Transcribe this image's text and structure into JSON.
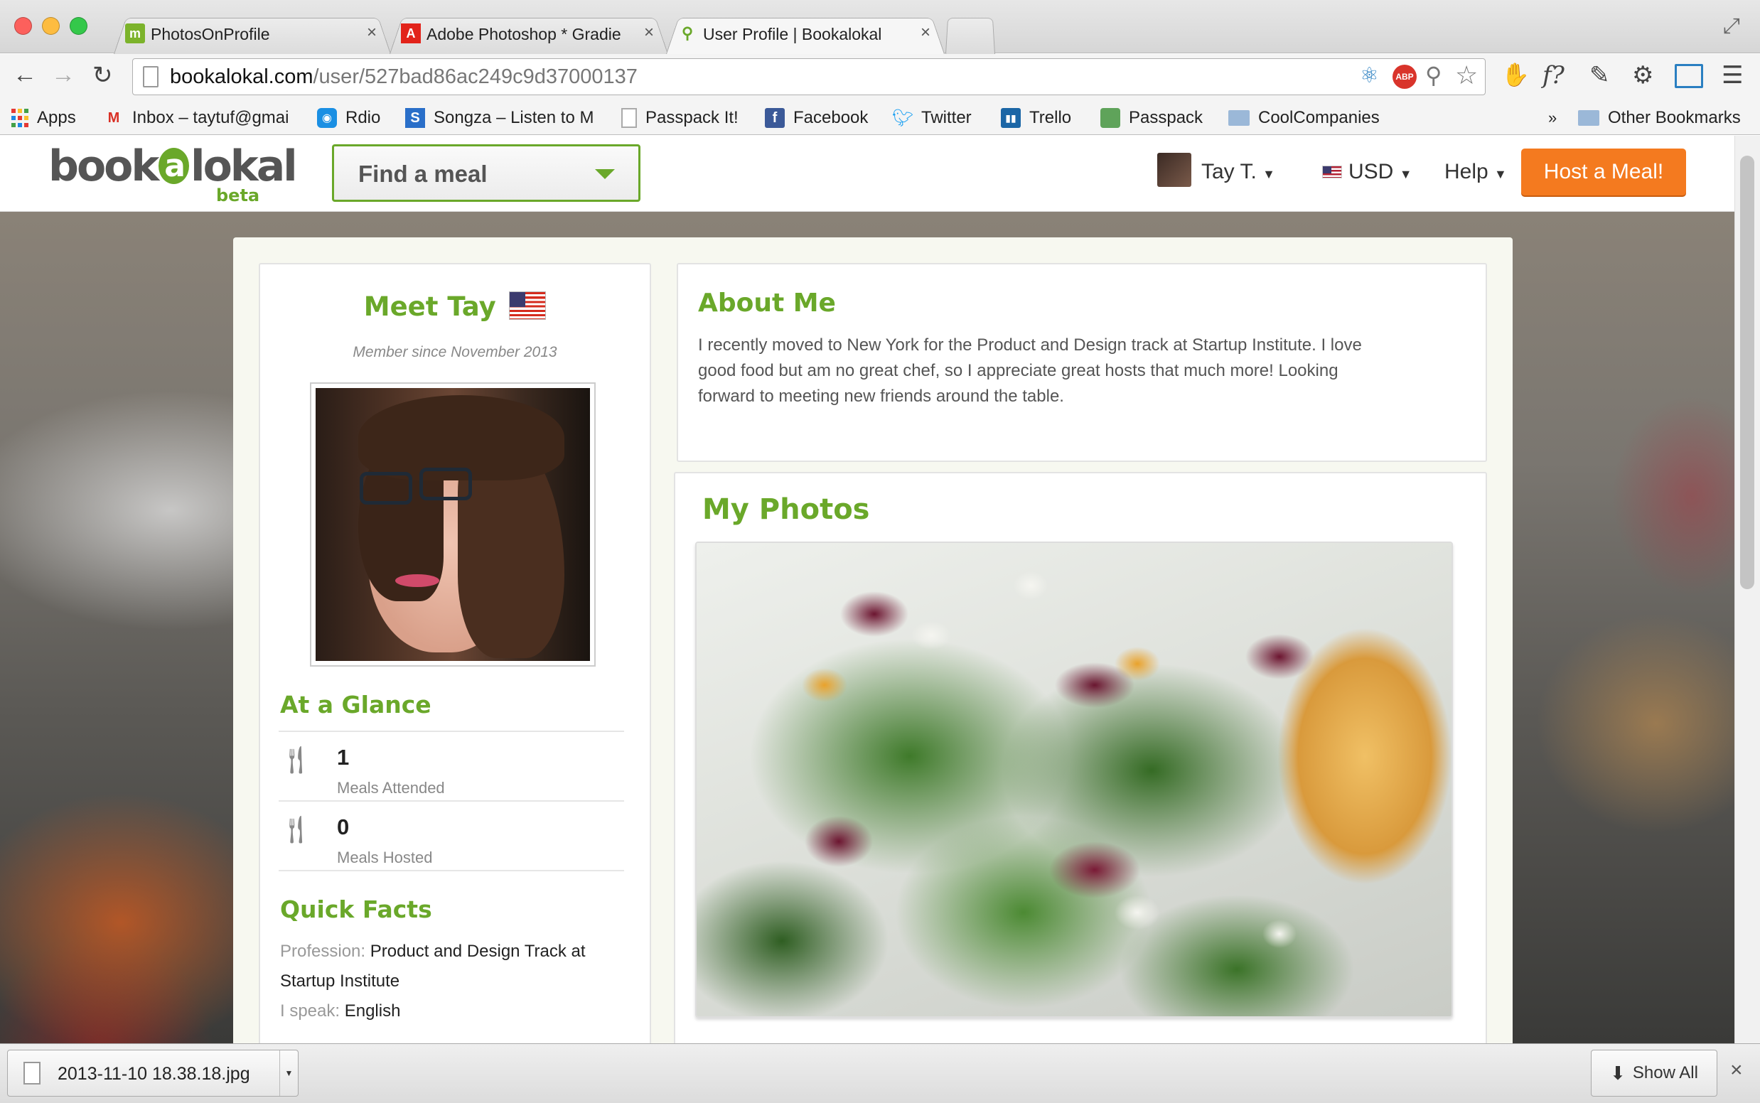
{
  "browser": {
    "tabs": [
      {
        "title": "PhotosOnProfile",
        "icon": "trello-like-green-icon",
        "active": false
      },
      {
        "title": "Adobe Photoshop * Gradie",
        "icon": "adobe-icon",
        "active": false
      },
      {
        "title": "User Profile | Bookalokal",
        "icon": "bookalokal-icon",
        "active": true
      }
    ],
    "url_host": "bookalokal.com",
    "url_path": "/user/527bad86ac249c9d37000137",
    "bookmarks": [
      {
        "label": "Apps",
        "icon": "apps-grid-icon"
      },
      {
        "label": "Inbox – taytuf@gmai",
        "icon": "gmail-icon"
      },
      {
        "label": "Rdio",
        "icon": "rdio-icon"
      },
      {
        "label": "Songza – Listen to M",
        "icon": "songza-icon"
      },
      {
        "label": "Passpack It!",
        "icon": "page-icon"
      },
      {
        "label": "Facebook",
        "icon": "facebook-icon"
      },
      {
        "label": "Twitter",
        "icon": "twitter-icon"
      },
      {
        "label": "Trello",
        "icon": "trello-icon"
      },
      {
        "label": "Passpack",
        "icon": "passpack-icon"
      },
      {
        "label": "CoolCompanies",
        "icon": "folder-icon"
      }
    ],
    "overflow": "»",
    "other_bookmarks": "Other Bookmarks"
  },
  "site": {
    "logo_main": "book",
    "logo_at": "a",
    "logo_end": "lokal",
    "logo_beta": "beta",
    "find_meal": "Find a meal",
    "user_name": "Tay T.",
    "currency": "USD",
    "help": "Help",
    "host_button": "Host a Meal!"
  },
  "profile": {
    "meet": "Meet Tay",
    "member_since": "Member since November 2013",
    "glance_title": "At a Glance",
    "stats": [
      {
        "value": "1",
        "label": "Meals Attended"
      },
      {
        "value": "0",
        "label": "Meals Hosted"
      }
    ],
    "quick_facts_title": "Quick Facts",
    "profession_label": "Profession:",
    "profession_value_1": "Product and Design Track at",
    "profession_value_2": "Startup Institute",
    "speak_label": "I speak:",
    "speak_value": "English"
  },
  "about": {
    "title": "About Me",
    "line1": "I recently moved to New York for the Product and Design track at Startup Institute. I love",
    "line2": "good food but am no great chef, so I appreciate great hosts that much more! Looking",
    "line3": "forward to meeting new friends around the table."
  },
  "photos": {
    "title": "My Photos"
  },
  "downloads": {
    "file": "2013-11-10 18.38.18.jpg",
    "show_all": "Show All"
  },
  "colors": {
    "brand_green": "#6aa82a",
    "host_orange": "#f47a1f"
  }
}
